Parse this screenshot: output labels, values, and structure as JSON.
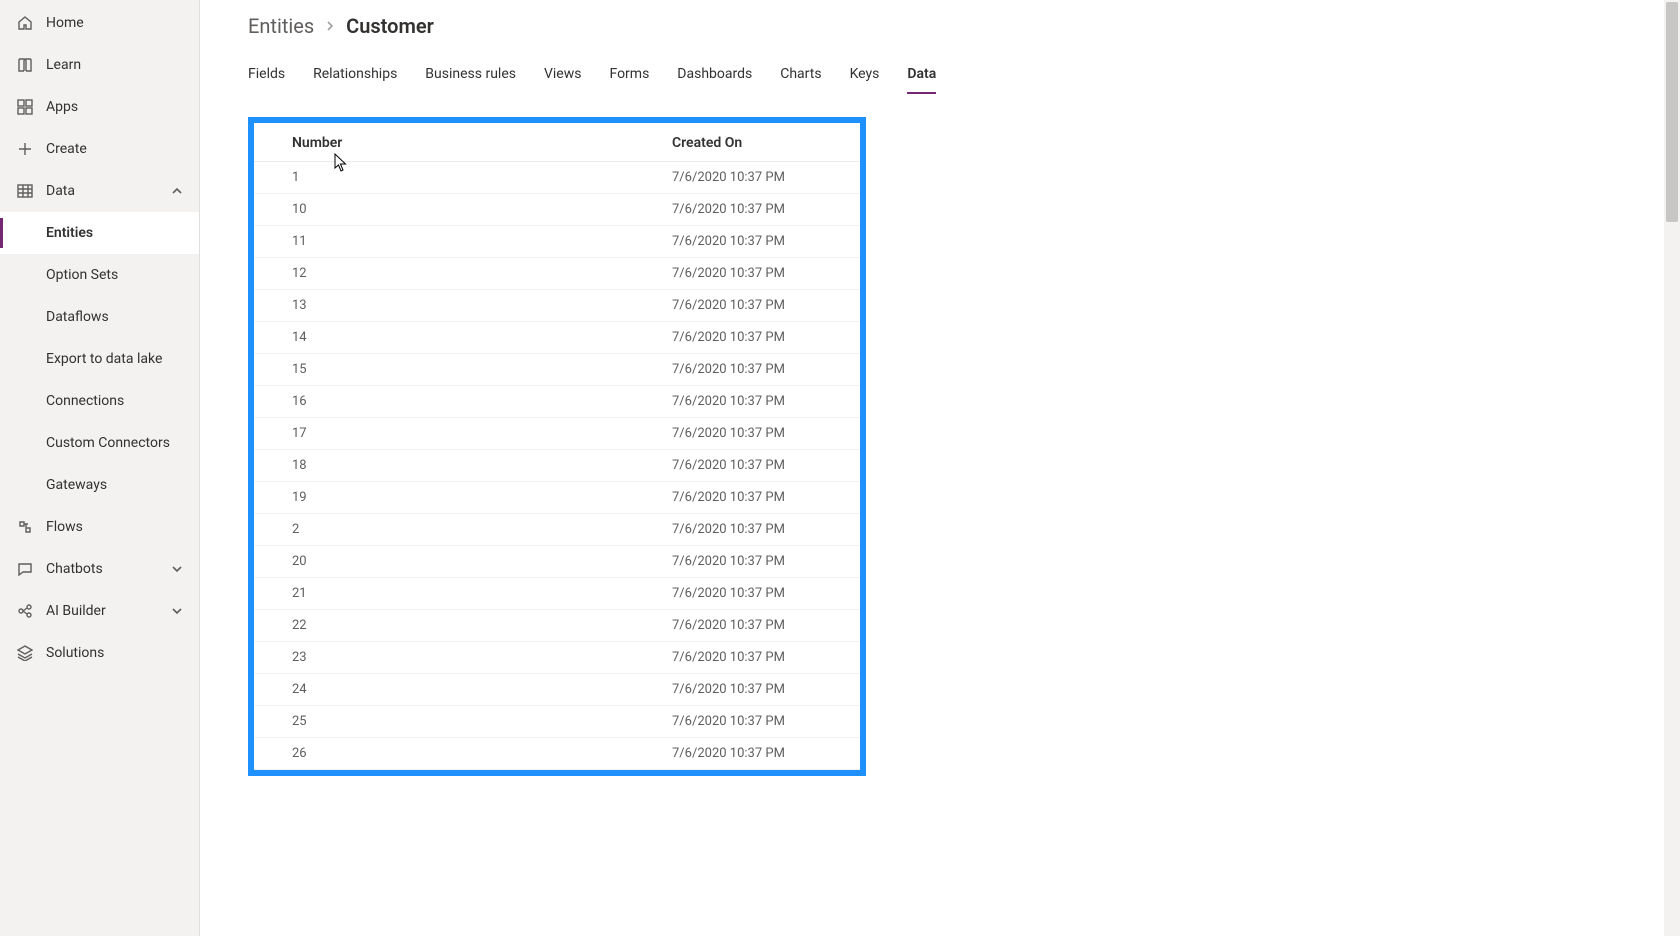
{
  "sidebar": {
    "items": [
      {
        "id": "home",
        "label": "Home",
        "icon": "home"
      },
      {
        "id": "learn",
        "label": "Learn",
        "icon": "book"
      },
      {
        "id": "apps",
        "label": "Apps",
        "icon": "grid"
      },
      {
        "id": "create",
        "label": "Create",
        "icon": "plus"
      },
      {
        "id": "data",
        "label": "Data",
        "icon": "table",
        "expandable": true,
        "expanded": true,
        "children": [
          {
            "id": "entities",
            "label": "Entities",
            "active": true
          },
          {
            "id": "option-sets",
            "label": "Option Sets"
          },
          {
            "id": "dataflows",
            "label": "Dataflows"
          },
          {
            "id": "export-data-lake",
            "label": "Export to data lake"
          },
          {
            "id": "connections",
            "label": "Connections"
          },
          {
            "id": "custom-connectors",
            "label": "Custom Connectors"
          },
          {
            "id": "gateways",
            "label": "Gateways"
          }
        ]
      },
      {
        "id": "flows",
        "label": "Flows",
        "icon": "flow"
      },
      {
        "id": "chatbots",
        "label": "Chatbots",
        "icon": "chat",
        "expandable": true,
        "expanded": false
      },
      {
        "id": "aibuilder",
        "label": "AI Builder",
        "icon": "ai",
        "expandable": true,
        "expanded": false
      },
      {
        "id": "solutions",
        "label": "Solutions",
        "icon": "layers"
      }
    ]
  },
  "breadcrumb": {
    "parent": "Entities",
    "current": "Customer"
  },
  "tabs": [
    {
      "id": "fields",
      "label": "Fields"
    },
    {
      "id": "relationships",
      "label": "Relationships"
    },
    {
      "id": "business-rules",
      "label": "Business rules"
    },
    {
      "id": "views",
      "label": "Views"
    },
    {
      "id": "forms",
      "label": "Forms"
    },
    {
      "id": "dashboards",
      "label": "Dashboards"
    },
    {
      "id": "charts",
      "label": "Charts"
    },
    {
      "id": "keys",
      "label": "Keys"
    },
    {
      "id": "data",
      "label": "Data",
      "active": true
    }
  ],
  "table": {
    "headers": {
      "number": "Number",
      "created": "Created On"
    },
    "rows": [
      {
        "number": "1",
        "created": "7/6/2020 10:37 PM"
      },
      {
        "number": "10",
        "created": "7/6/2020 10:37 PM"
      },
      {
        "number": "11",
        "created": "7/6/2020 10:37 PM"
      },
      {
        "number": "12",
        "created": "7/6/2020 10:37 PM"
      },
      {
        "number": "13",
        "created": "7/6/2020 10:37 PM"
      },
      {
        "number": "14",
        "created": "7/6/2020 10:37 PM"
      },
      {
        "number": "15",
        "created": "7/6/2020 10:37 PM"
      },
      {
        "number": "16",
        "created": "7/6/2020 10:37 PM"
      },
      {
        "number": "17",
        "created": "7/6/2020 10:37 PM"
      },
      {
        "number": "18",
        "created": "7/6/2020 10:37 PM"
      },
      {
        "number": "19",
        "created": "7/6/2020 10:37 PM"
      },
      {
        "number": "2",
        "created": "7/6/2020 10:37 PM"
      },
      {
        "number": "20",
        "created": "7/6/2020 10:37 PM"
      },
      {
        "number": "21",
        "created": "7/6/2020 10:37 PM"
      },
      {
        "number": "22",
        "created": "7/6/2020 10:37 PM"
      },
      {
        "number": "23",
        "created": "7/6/2020 10:37 PM"
      },
      {
        "number": "24",
        "created": "7/6/2020 10:37 PM"
      },
      {
        "number": "25",
        "created": "7/6/2020 10:37 PM"
      },
      {
        "number": "26",
        "created": "7/6/2020 10:37 PM"
      }
    ]
  },
  "highlight_color": "#1e90ff"
}
